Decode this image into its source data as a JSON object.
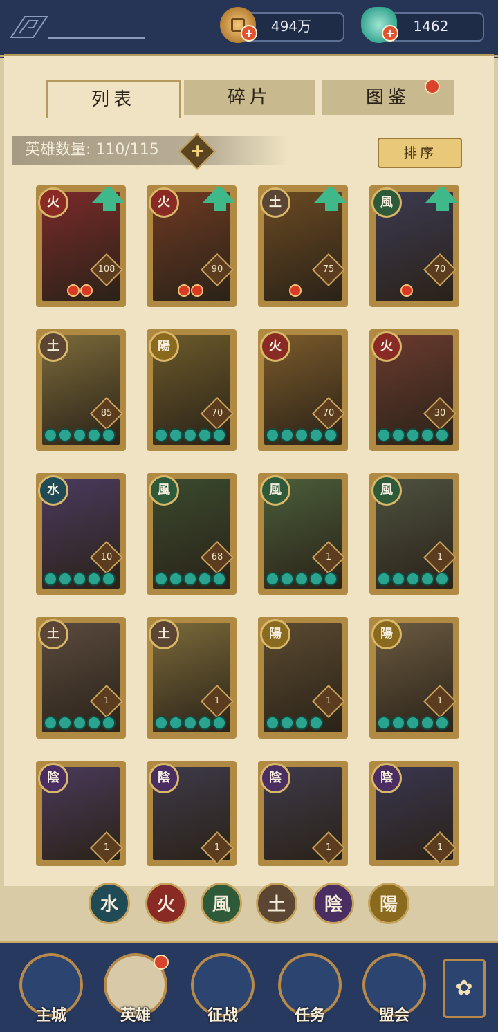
{
  "header": {
    "coin_value": "494万",
    "jade_value": "1462",
    "coin_icon": "coin-icon",
    "jade_icon": "jade-pouch-icon",
    "plus_symbol": "+"
  },
  "tabs": [
    {
      "label": "列表",
      "active": true
    },
    {
      "label": "碎片",
      "active": false
    },
    {
      "label": "图鉴",
      "active": false,
      "notification": true
    }
  ],
  "hero_count": {
    "label": "英雄数量: 110/115",
    "plus_symbol": "+"
  },
  "sort_button": "排序",
  "heroes": [
    {
      "element": "火",
      "level": "108",
      "upgrade": true,
      "stars": 0,
      "fire": 2,
      "color": "#7a2a2a"
    },
    {
      "element": "火",
      "level": "90",
      "upgrade": true,
      "stars": 0,
      "fire": 2,
      "color": "#6e3a22"
    },
    {
      "element": "土",
      "level": "75",
      "upgrade": true,
      "stars": 0,
      "fire": 1,
      "color": "#6a4a22"
    },
    {
      "element": "風",
      "level": "70",
      "upgrade": true,
      "stars": 0,
      "fire": 1,
      "color": "#3c3a52"
    },
    {
      "element": "土",
      "level": "85",
      "upgrade": false,
      "stars": 5,
      "fire": 0,
      "color": "#7b6a3a"
    },
    {
      "element": "陽",
      "level": "70",
      "upgrade": false,
      "stars": 5,
      "fire": 0,
      "color": "#6c5a2a"
    },
    {
      "element": "火",
      "level": "70",
      "upgrade": false,
      "stars": 5,
      "fire": 0,
      "color": "#7a5a2a"
    },
    {
      "element": "火",
      "level": "30",
      "upgrade": false,
      "stars": 5,
      "fire": 0,
      "color": "#6a3a2e"
    },
    {
      "element": "水",
      "level": "10",
      "upgrade": false,
      "stars": 5,
      "fire": 0,
      "color": "#4a3a5e"
    },
    {
      "element": "風",
      "level": "68",
      "upgrade": false,
      "stars": 5,
      "fire": 0,
      "color": "#3a4a2e"
    },
    {
      "element": "風",
      "level": "1",
      "upgrade": false,
      "stars": 5,
      "fire": 0,
      "color": "#4a5e3a"
    },
    {
      "element": "風",
      "level": "1",
      "upgrade": false,
      "stars": 5,
      "fire": 0,
      "color": "#4e5240"
    },
    {
      "element": "土",
      "level": "1",
      "upgrade": false,
      "stars": 5,
      "fire": 0,
      "color": "#5a4a3e"
    },
    {
      "element": "土",
      "level": "1",
      "upgrade": false,
      "stars": 5,
      "fire": 0,
      "color": "#7b6a3a"
    },
    {
      "element": "陽",
      "level": "1",
      "upgrade": false,
      "stars": 4,
      "fire": 0,
      "color": "#5a4a30"
    },
    {
      "element": "陽",
      "level": "1",
      "upgrade": false,
      "stars": 5,
      "fire": 0,
      "color": "#6a5a40"
    },
    {
      "element": "陰",
      "level": "1",
      "upgrade": false,
      "stars": 0,
      "fire": 0,
      "color": "#4a3a5a"
    },
    {
      "element": "陰",
      "level": "1",
      "upgrade": false,
      "stars": 0,
      "fire": 0,
      "color": "#3e3a4a"
    },
    {
      "element": "陰",
      "level": "1",
      "upgrade": false,
      "stars": 0,
      "fire": 0,
      "color": "#3e3a4a"
    },
    {
      "element": "陰",
      "level": "1",
      "upgrade": false,
      "stars": 0,
      "fire": 0,
      "color": "#3a3650"
    }
  ],
  "element_colors": {
    "火": "#8a2a24",
    "土": "#5a4632",
    "風": "#2e5a3a",
    "水": "#1f4a56",
    "陽": "#8a6a1e",
    "陰": "#4a2e62"
  },
  "filters": [
    "水",
    "火",
    "風",
    "土",
    "陰",
    "陽"
  ],
  "nav": [
    {
      "label": "主城",
      "icon": "city-gate-icon"
    },
    {
      "label": "英雄",
      "icon": "hero-portrait-icon",
      "notification": true
    },
    {
      "label": "征战",
      "icon": "battle-scroll-icon"
    },
    {
      "label": "任务",
      "icon": "quest-flag-icon"
    },
    {
      "label": "盟会",
      "icon": "guild-pavilion-icon"
    }
  ],
  "nav_extra_icon": "menu-flower-icon"
}
